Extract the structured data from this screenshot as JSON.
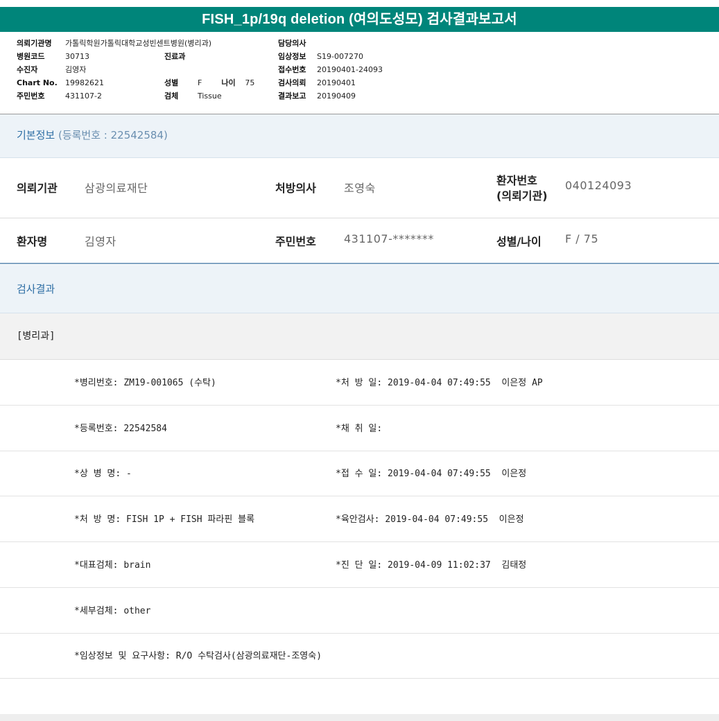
{
  "title": "FISH_1p/19q deletion (여의도성모) 검사결과보고서",
  "header": {
    "col1": [
      {
        "label": "의뢰기관명",
        "value": "가톨릭학원가톨릭대학교성빈센트병원(병리과)"
      },
      {
        "label": "병원코드",
        "value": "30713"
      },
      {
        "label": "수진자",
        "value": "김영자"
      },
      {
        "label": "Chart No.",
        "value": "19982621"
      },
      {
        "label": "주민번호",
        "value": "431107-2"
      }
    ],
    "col2": {
      "dept_label": "진료과",
      "dept_value": "",
      "sex_label": "성별",
      "sex_value": "F",
      "age_label": "나이",
      "age_value": "75",
      "specimen_label": "검체",
      "specimen_value": "Tissue"
    },
    "col3": [
      {
        "label": "담당의사",
        "value": ""
      },
      {
        "label": "임상정보",
        "value": "S19-007270"
      },
      {
        "label": "접수번호",
        "value": "20190401-24093"
      },
      {
        "label": "검사의뢰",
        "value": "20190401"
      },
      {
        "label": "결과보고",
        "value": "20190409"
      }
    ]
  },
  "basic_info": {
    "heading": "기본정보",
    "reg_text": "(등록번호 : 22542584)",
    "row1": {
      "inst_label": "의뢰기관",
      "inst_value": "삼광의료재단",
      "doctor_label": "처방의사",
      "doctor_value": "조영숙",
      "pid_label_1": "환자번호",
      "pid_label_2": "(의뢰기관)",
      "pid_value": "040124093"
    },
    "row2": {
      "name_label": "환자명",
      "name_value": "김영자",
      "rrn_label": "주민번호",
      "rrn_value": "431107-*******",
      "sexage_label": "성별/나이",
      "sexage_value": "F / 75"
    }
  },
  "result": {
    "heading": "검사결과",
    "dept": "[병리과]",
    "rows": [
      {
        "left": "*병리번호: ZM19-001065 (수탁)",
        "right": "*처 방 일: 2019-04-04 07:49:55  이은정 AP"
      },
      {
        "left": "*등록번호: 22542584",
        "right": "*채 취 일:"
      },
      {
        "left": "*상 병 명: -",
        "right": "*접 수 일: 2019-04-04 07:49:55  이은정"
      },
      {
        "left": "*처 방 명: FISH 1P + FISH 파라핀 블록",
        "right": "*육안검사: 2019-04-04 07:49:55  이은정"
      },
      {
        "left": "*대표검체: brain",
        "right": "*진 단 일: 2019-04-09 11:02:37  김태정"
      },
      {
        "left": "*세부검체: other",
        "right": ""
      },
      {
        "left": "*임상정보 및 요구사항: R/O 수탁검사(삼광의료재단-조영숙)",
        "right": ""
      }
    ]
  }
}
